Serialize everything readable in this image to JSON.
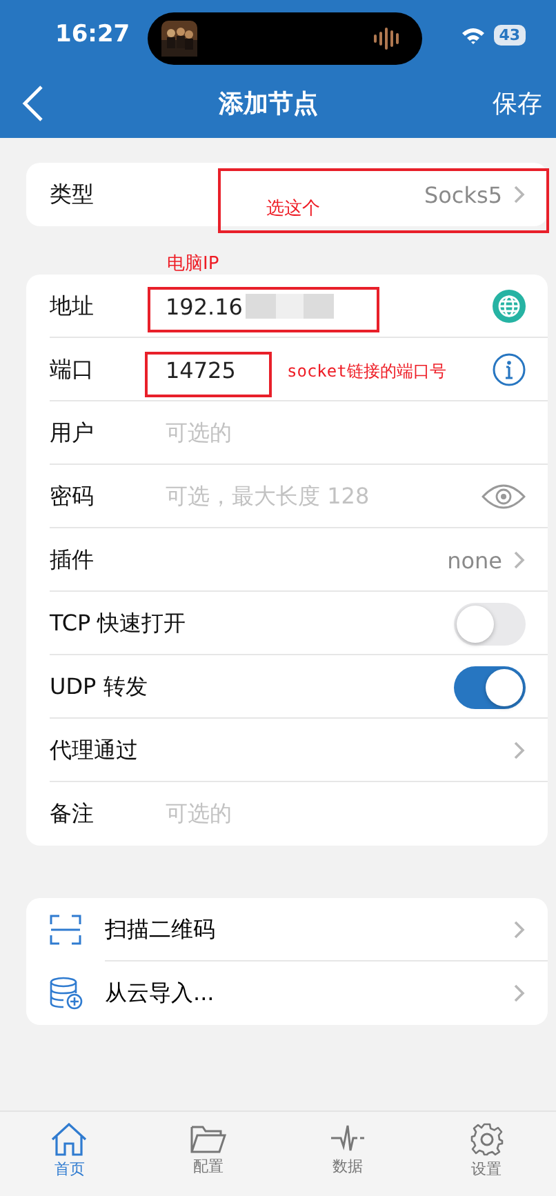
{
  "status_bar": {
    "time": "16:27",
    "battery": "43"
  },
  "nav": {
    "title": "添加节点",
    "action": "保存"
  },
  "type_row": {
    "label": "类型",
    "value": "Socks5",
    "annotation": {
      "note": "选这个"
    }
  },
  "form": [
    {
      "kind": "address",
      "label": "地址",
      "value": "192.16",
      "redacted": true,
      "annotation": {
        "note": "电脑IP"
      }
    },
    {
      "kind": "port",
      "label": "端口",
      "value": "14725",
      "annotation": {
        "note": "socket链接的端口号"
      }
    },
    {
      "kind": "text",
      "label": "用户",
      "placeholder": "可选的"
    },
    {
      "kind": "password",
      "label": "密码",
      "placeholder": "可选，最大长度 128"
    },
    {
      "kind": "select",
      "label": "插件",
      "value": "none"
    },
    {
      "kind": "toggle",
      "label": "TCP 快速打开",
      "on": false
    },
    {
      "kind": "toggle",
      "label": "UDP 转发",
      "on": true
    },
    {
      "kind": "select",
      "label": "代理通过"
    },
    {
      "kind": "text",
      "label": "备注",
      "placeholder": "可选的"
    }
  ],
  "actions": [
    {
      "kind": "scan",
      "label": "扫描二维码"
    },
    {
      "kind": "cloud",
      "label": "从云导入..."
    }
  ],
  "tabs": [
    {
      "kind": "home",
      "label": "首页",
      "selected": true
    },
    {
      "kind": "folder",
      "label": "配置",
      "selected": false
    },
    {
      "kind": "pulse",
      "label": "数据",
      "selected": false
    },
    {
      "kind": "gear",
      "label": "设置",
      "selected": false
    }
  ]
}
